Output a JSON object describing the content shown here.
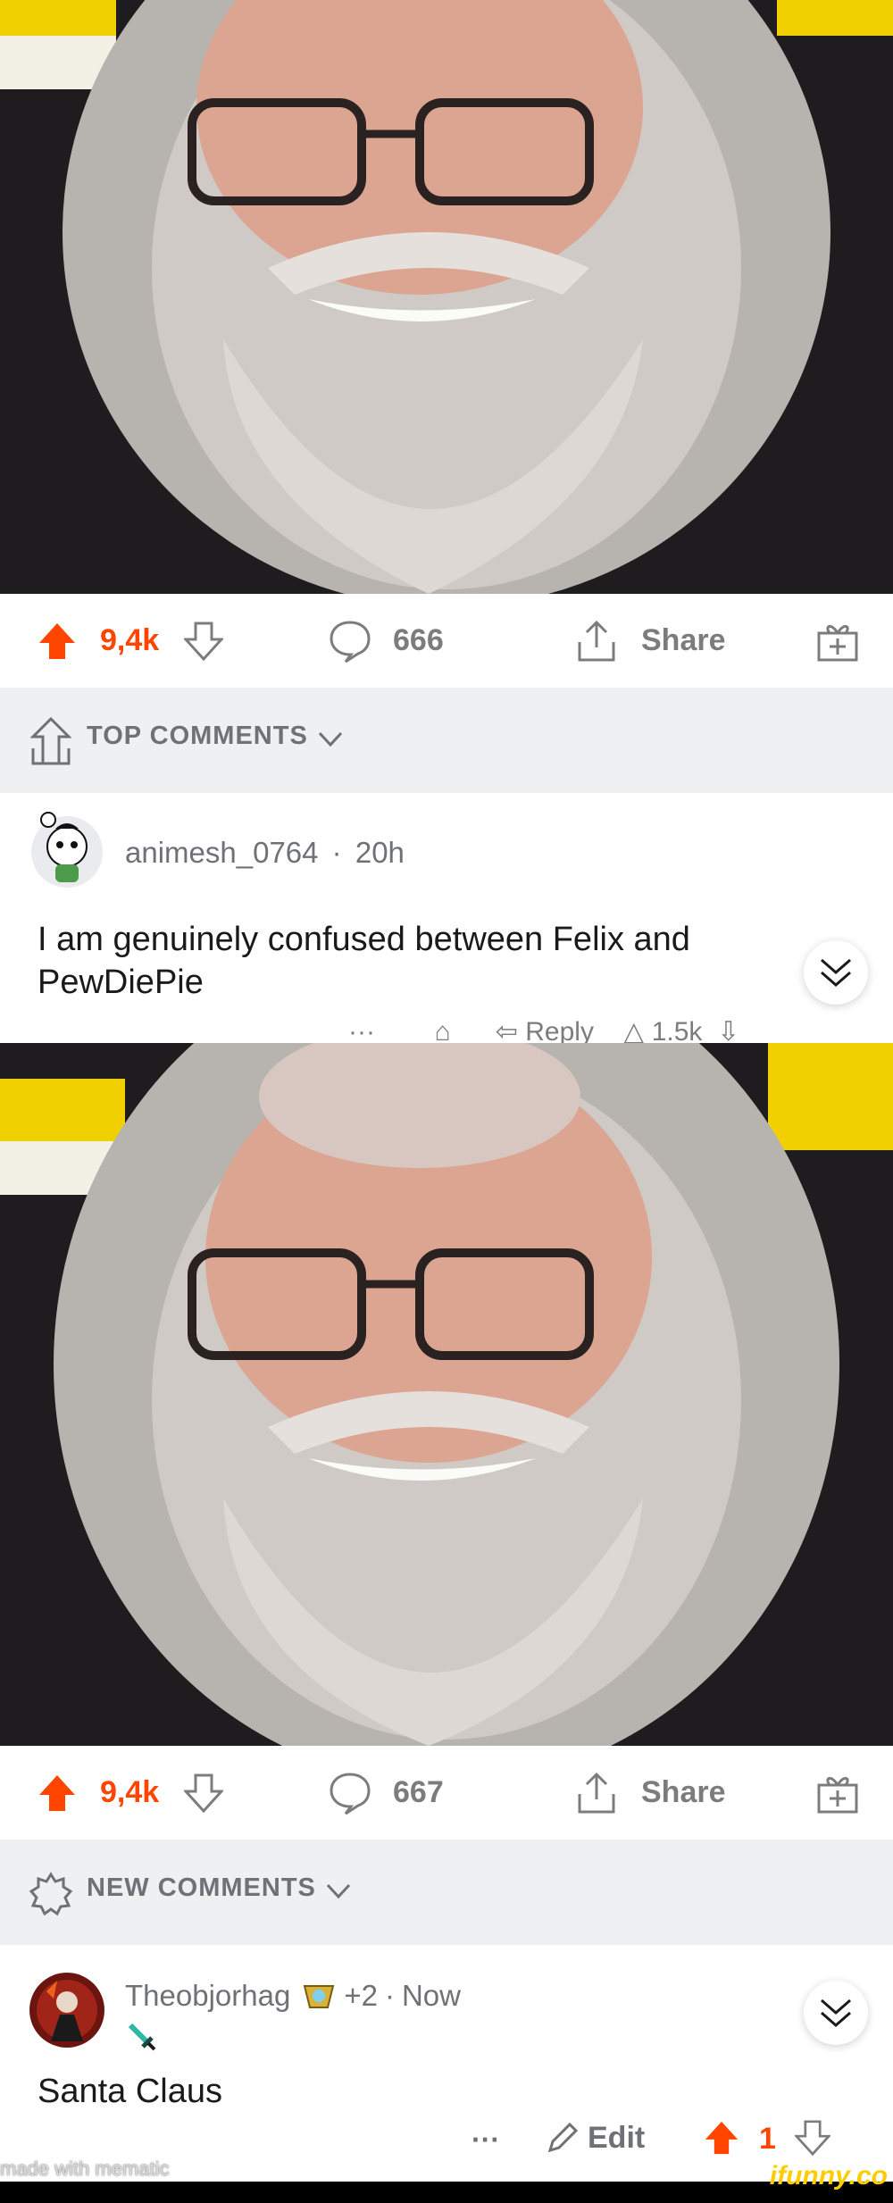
{
  "post1": {
    "upvotes": "9,4k",
    "comments": "666",
    "share_label": "Share",
    "section_label": "TOP COMMENTS",
    "comment": {
      "username": "animesh_0764",
      "separator": "·",
      "time": "20h",
      "body_line1": "I am genuinely confused between Felix and",
      "body_line2": "PewDiePie",
      "clipped_actions": "···        ⌂      ⇦ Reply    △ 1.5k  ⇩"
    }
  },
  "post2": {
    "upvotes": "9,4k",
    "comments": "667",
    "share_label": "Share",
    "section_label": "NEW COMMENTS",
    "comment": {
      "username": "Theobjorhag",
      "award_count": "+2",
      "separator": "·",
      "time": "Now",
      "body": "Santa Claus",
      "more": "···",
      "edit_label": "Edit",
      "votes": "1"
    }
  },
  "watermark": "made with mematic",
  "brand": "ifunny.co",
  "colors": {
    "upvote": "#ff4500",
    "gray": "#7c7c7c",
    "header_bg": "#eff0f2"
  }
}
